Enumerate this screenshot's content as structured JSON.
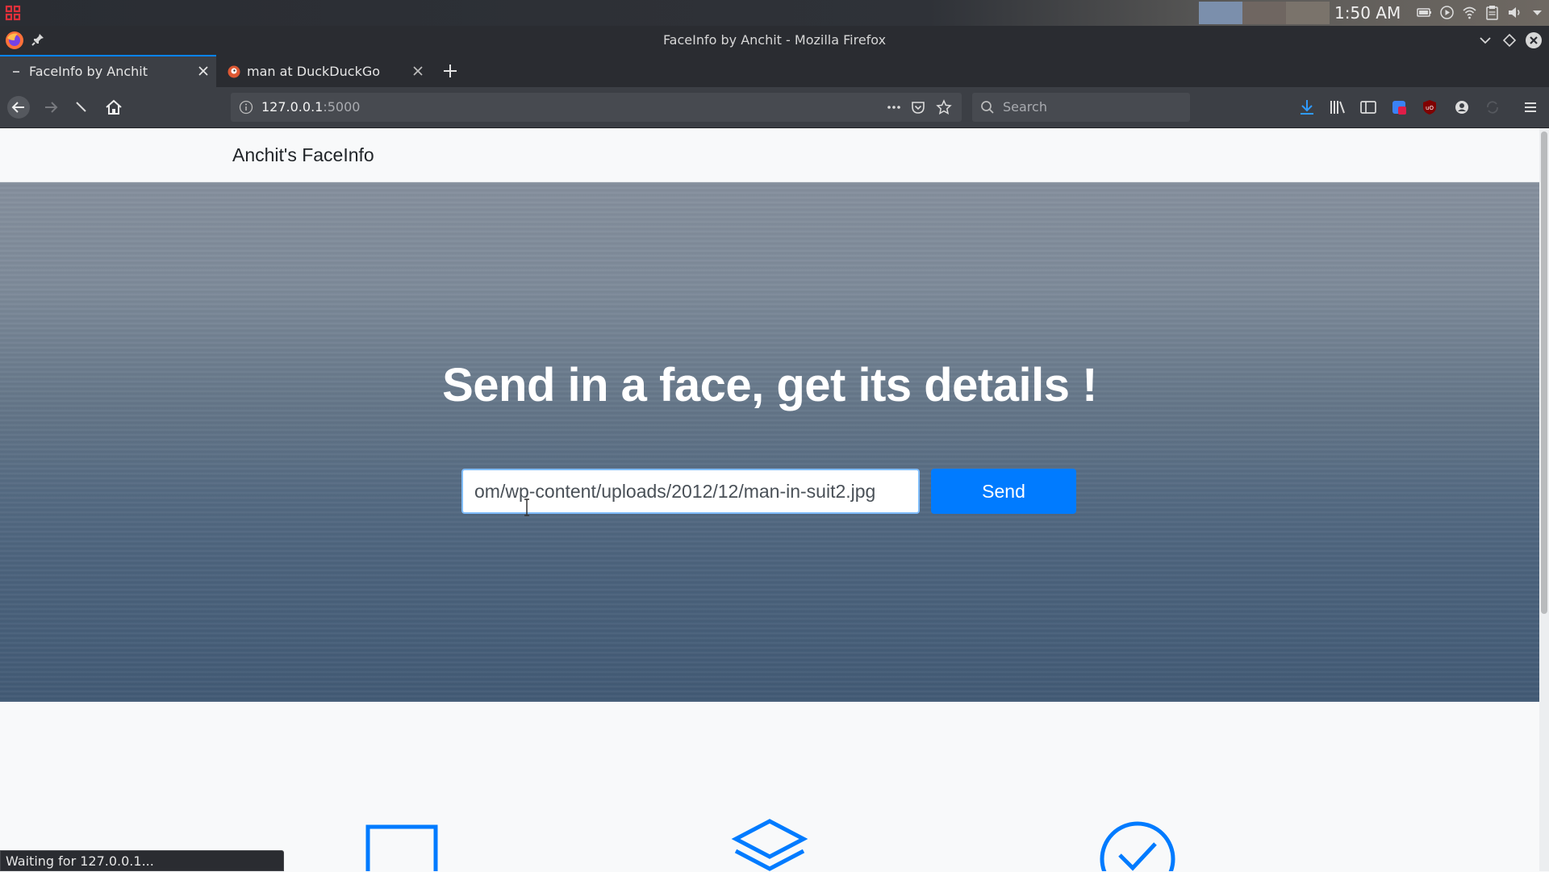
{
  "system_panel": {
    "clock": "1:50 AM",
    "icons": [
      "app-menu-icon",
      "battery-icon",
      "media-icon",
      "wifi-icon",
      "clipboard-icon",
      "volume-icon",
      "chevron-down-icon"
    ]
  },
  "window": {
    "title": "FaceInfo by Anchit - Mozilla Firefox"
  },
  "tabs": [
    {
      "label": "FaceInfo by Anchit",
      "active": true
    },
    {
      "label": "man at DuckDuckGo",
      "active": false
    }
  ],
  "navbar": {
    "url_host": "127.0.0.1",
    "url_port": ":5000",
    "search_placeholder": "Search"
  },
  "page": {
    "brand": "Anchit's FaceInfo",
    "hero_title": "Send in a face, get its details !",
    "input_value": "om/wp-content/uploads/2012/12/man-in-suit2.jpg",
    "send_label": "Send"
  },
  "status": "Waiting for 127.0.0.1...",
  "colors": {
    "accent": "#007bff",
    "firefox_blue": "#0a84ff",
    "chrome_dark": "#2a2c31"
  }
}
